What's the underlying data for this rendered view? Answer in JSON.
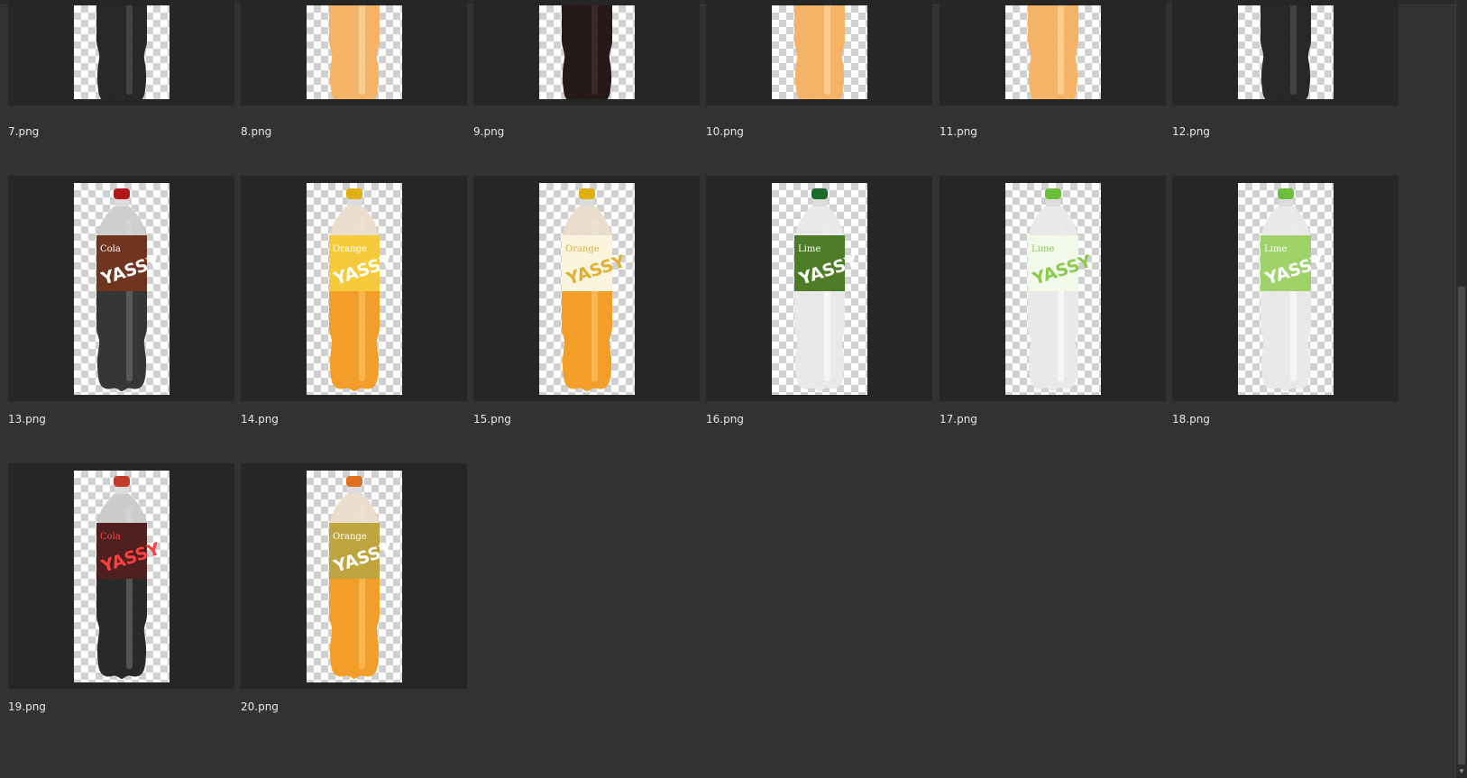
{
  "files": [
    {
      "name": "7.png",
      "style": "dark-gray",
      "row": 0,
      "col": 0
    },
    {
      "name": "8.png",
      "style": "orange-light",
      "row": 0,
      "col": 1
    },
    {
      "name": "9.png",
      "style": "dark-brown",
      "row": 0,
      "col": 2
    },
    {
      "name": "10.png",
      "style": "orange-light",
      "row": 0,
      "col": 3
    },
    {
      "name": "11.png",
      "style": "orange-light",
      "row": 0,
      "col": 4
    },
    {
      "name": "12.png",
      "style": "dark-gray",
      "row": 0,
      "col": 5
    },
    {
      "name": "13.png",
      "style": "cola-label",
      "row": 1,
      "col": 0,
      "label": "Cola"
    },
    {
      "name": "14.png",
      "style": "orange-yellow-label",
      "row": 1,
      "col": 1,
      "label": "Orange"
    },
    {
      "name": "15.png",
      "style": "orange-white-label",
      "row": 1,
      "col": 2,
      "label": "Orange"
    },
    {
      "name": "16.png",
      "style": "lime-darkgreen-label",
      "row": 1,
      "col": 3,
      "label": "Lime"
    },
    {
      "name": "17.png",
      "style": "lime-white-label",
      "row": 1,
      "col": 4,
      "label": "Lime"
    },
    {
      "name": "18.png",
      "style": "lime-lightgreen-label",
      "row": 1,
      "col": 5,
      "label": "Lime"
    },
    {
      "name": "19.png",
      "style": "cola-red-label",
      "row": 2,
      "col": 0,
      "label": "Cola"
    },
    {
      "name": "20.png",
      "style": "orange-fruit-label",
      "row": 2,
      "col": 1,
      "label": "Orange"
    }
  ],
  "brand": "YASSY",
  "colors": {
    "panel_bg": "#323232",
    "tile_bg": "#262626",
    "text": "#e6e6e6"
  },
  "scrollbar": {
    "arrow": "▾"
  }
}
